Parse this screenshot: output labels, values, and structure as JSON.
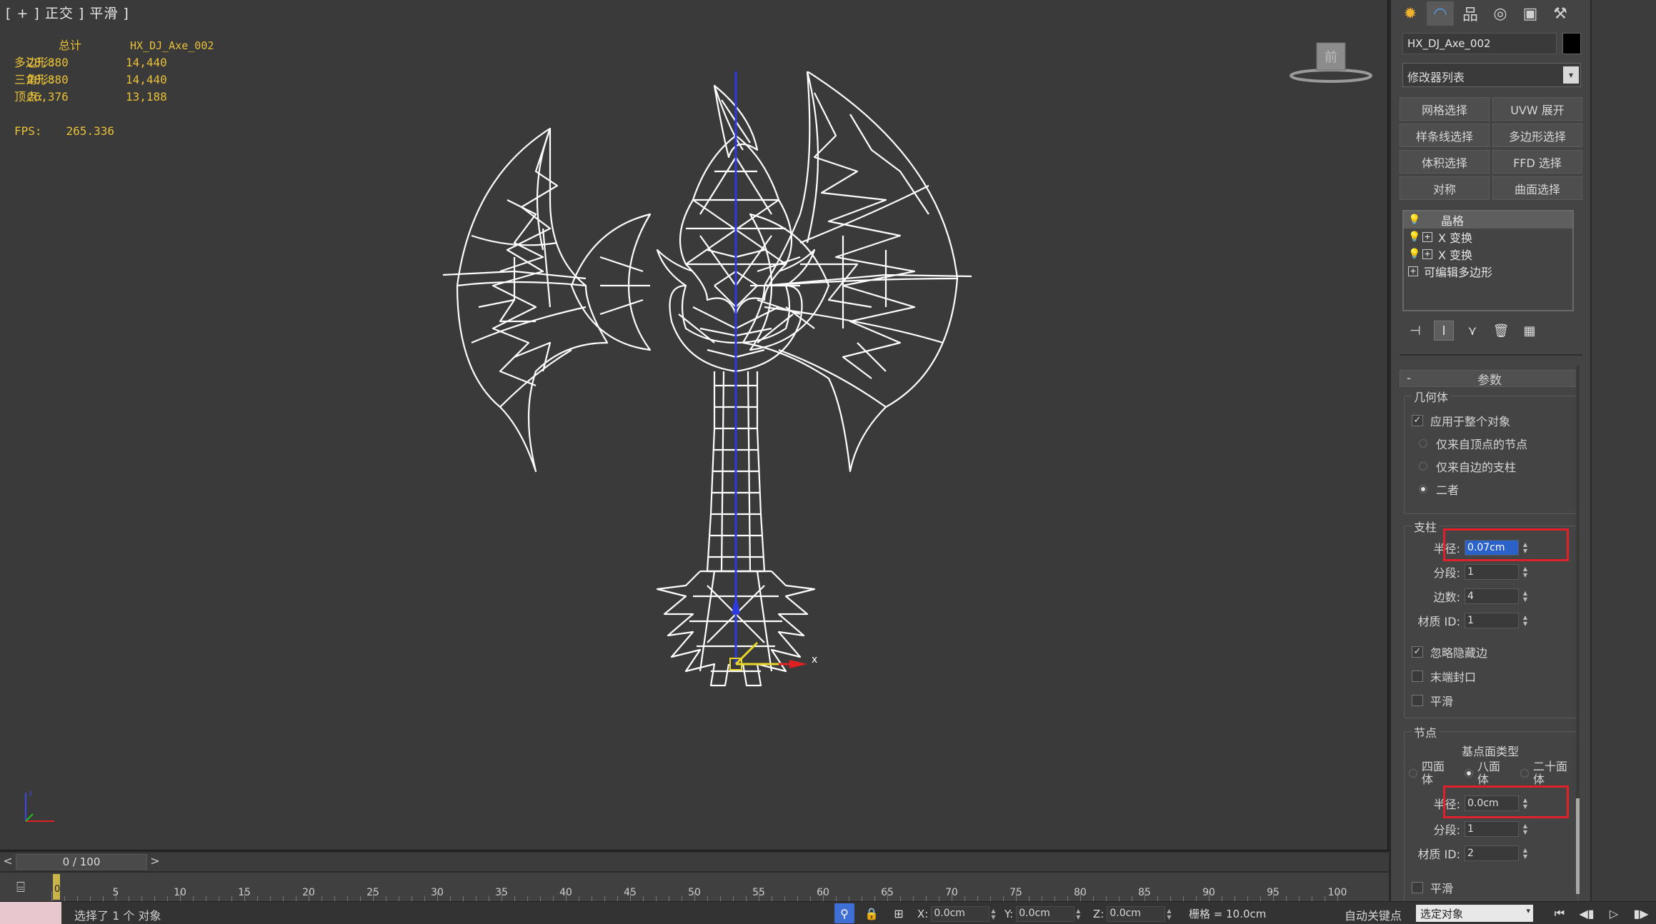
{
  "viewport": {
    "label": "[ + ] 正交 ] 平滑 ]",
    "stats": {
      "header_total": "总计",
      "header_object": "HX_DJ_Axe_002",
      "rows": [
        {
          "label": "多边形:",
          "total": "28,880",
          "object": "14,440"
        },
        {
          "label": "三角形:",
          "total": "28,880",
          "object": "14,440"
        },
        {
          "label": "顶点:",
          "total": "26,376",
          "object": "13,188"
        }
      ],
      "fps_label": "FPS:",
      "fps_value": "265.336"
    },
    "viewcube_label": "前",
    "gizmo_x_label": "x",
    "wire_color": "#ffffff",
    "background_color": "#3a3a3a"
  },
  "command_panel": {
    "tabs": [
      {
        "icon": "create-icon",
        "glyph": "✹"
      },
      {
        "icon": "modify-icon",
        "glyph": "◠"
      },
      {
        "icon": "hierarchy-icon",
        "glyph": "品"
      },
      {
        "icon": "motion-icon",
        "glyph": "◎"
      },
      {
        "icon": "display-icon",
        "glyph": "▣"
      },
      {
        "icon": "utilities-icon",
        "glyph": "⚒"
      }
    ],
    "object_name": "HX_DJ_Axe_002",
    "object_color": "#000000",
    "modifier_list": "修改器列表",
    "modifier_buttons": [
      "网格选择",
      "UVW 展开",
      "样条线选择",
      "多边形选择",
      "体积选择",
      "FFD 选择",
      "对称",
      "曲面选择"
    ],
    "stack": [
      {
        "label": "晶格",
        "bulb": true,
        "plus": false,
        "selected": true
      },
      {
        "label": "X 变换",
        "bulb": true,
        "plus": true,
        "selected": false
      },
      {
        "label": "X 变换",
        "bulb": true,
        "plus": true,
        "selected": false
      },
      {
        "label": "可编辑多边形",
        "bulb": false,
        "plus": true,
        "selected": false
      }
    ],
    "rollout": {
      "minus": "-",
      "title": "参数",
      "geometry": {
        "title": "几何体",
        "apply_whole": "应用于整个对象",
        "opt_joints": "仅来自顶点的节点",
        "opt_struts": "仅来自边的支柱",
        "opt_both": "二者"
      },
      "struts": {
        "title": "支柱",
        "radius_label": "半径:",
        "radius_value": "0.07cm",
        "segments_label": "分段:",
        "segments_value": "1",
        "sides_label": "边数:",
        "sides_value": "4",
        "matid_label": "材质 ID:",
        "matid_value": "1",
        "ignore_hidden": "忽略隐藏边",
        "end_caps": "末端封口",
        "smooth": "平滑"
      },
      "joints": {
        "title": "节点",
        "base_type": "基点面类型",
        "tetra": "四面体",
        "octa": "八面体",
        "icosa": "二十面体",
        "radius_label": "半径:",
        "radius_value": "0.0cm",
        "segments_label": "分段:",
        "segments_value": "1",
        "matid_label": "材质 ID:",
        "matid_value": "2",
        "smooth": "平滑"
      }
    }
  },
  "timeline": {
    "prev": "<",
    "next": ">",
    "frame_display": "0 / 100",
    "current_frame": "0",
    "tick_labels": [
      "5",
      "10",
      "15",
      "20",
      "25",
      "30",
      "35",
      "40",
      "45",
      "50",
      "55",
      "60",
      "65",
      "70",
      "75",
      "80",
      "85",
      "90",
      "95",
      "100"
    ]
  },
  "statusbar": {
    "message": "选择了 1 个 对象",
    "x_label": "X:",
    "x_value": "0.0cm",
    "y_label": "Y:",
    "y_value": "0.0cm",
    "z_label": "Z:",
    "z_value": "0.0cm",
    "grid": "栅格 = 10.0cm",
    "auto_key": "自动关键点",
    "selection": "选定对象"
  }
}
